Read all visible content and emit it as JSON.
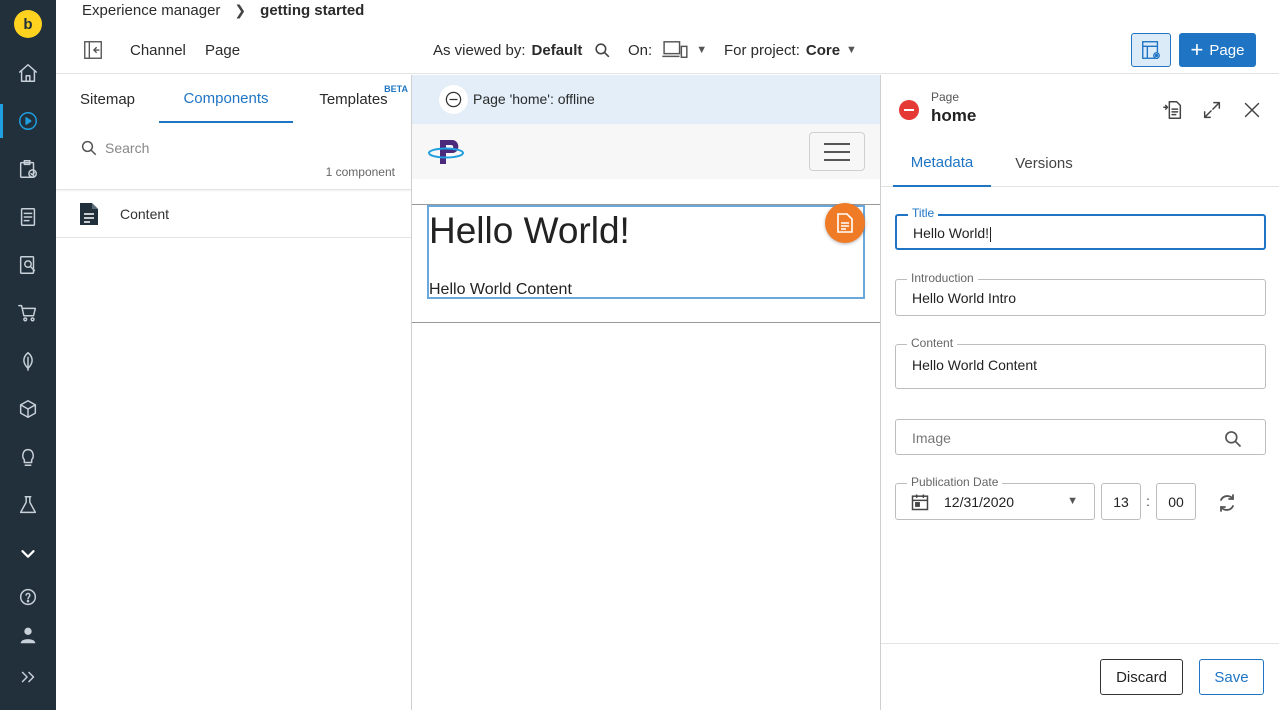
{
  "breadcrumb": {
    "root": "Experience manager",
    "current": "getting started"
  },
  "toolbar": {
    "channel": "Channel",
    "page": "Page",
    "viewed_by_label": "As viewed by:",
    "viewed_by_value": "Default",
    "on_label": "On:",
    "project_label": "For project:",
    "project_value": "Core",
    "new_page_label": "Page"
  },
  "left_panel": {
    "tabs": [
      "Sitemap",
      "Components",
      "Templates"
    ],
    "active_tab": "Components",
    "beta_badge": "BETA",
    "search_placeholder": "Search",
    "component_count": "1 component",
    "components": [
      {
        "name": "Content",
        "icon": "document-icon"
      }
    ]
  },
  "preview": {
    "banner": "Page 'home': offline",
    "heading": "Hello World!",
    "paragraph": "Hello World Content"
  },
  "right_panel": {
    "type": "Page",
    "name": "home",
    "tabs": [
      "Metadata",
      "Versions"
    ],
    "active_tab": "Metadata",
    "fields": {
      "title_label": "Title",
      "title_value": "Hello World!",
      "intro_label": "Introduction",
      "intro_value": "Hello World Intro",
      "content_label": "Content",
      "content_value": "Hello World Content",
      "image_placeholder": "Image",
      "pubdate_label": "Publication Date",
      "pubdate_value": "12/31/2020",
      "hour": "13",
      "minute": "00"
    },
    "discard": "Discard",
    "save": "Save"
  },
  "colors": {
    "rail_bg": "#22303c",
    "accent": "#1f75c4",
    "highlight": "#1f9ee0",
    "offline": "#e53935",
    "edit_fab": "#f07b26",
    "brand_logo": "#ffd21f"
  }
}
